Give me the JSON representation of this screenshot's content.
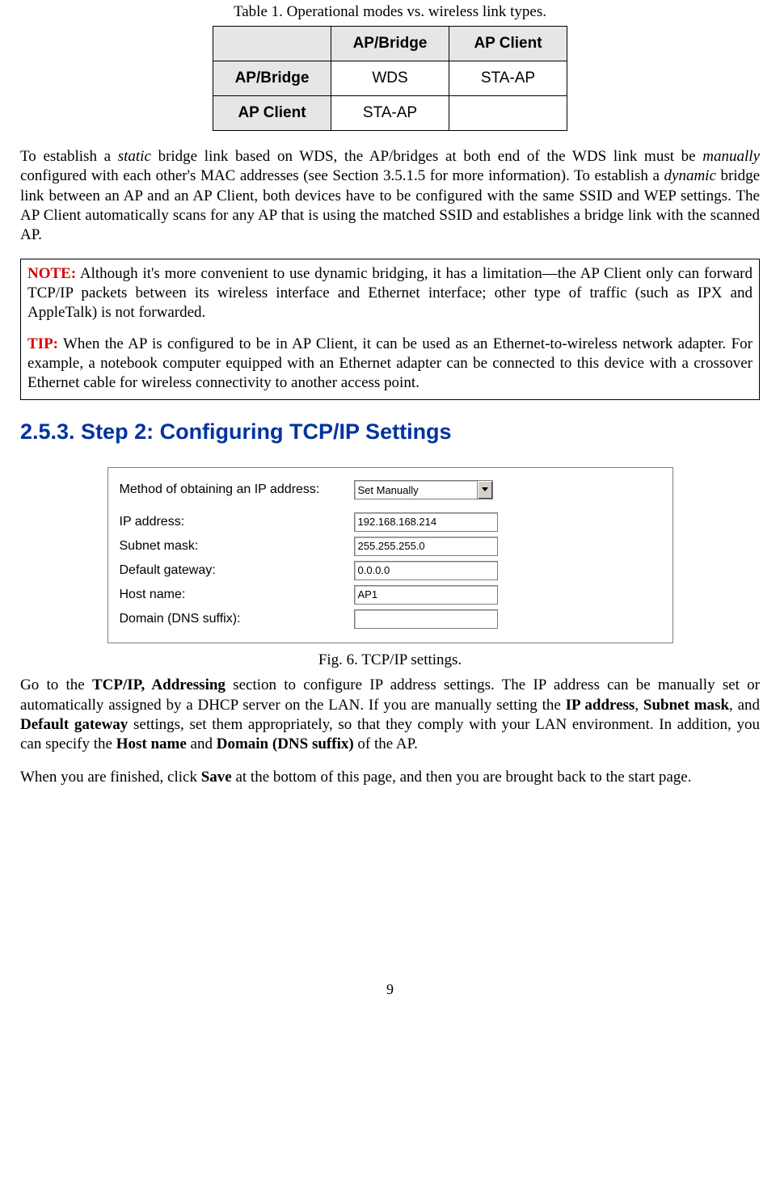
{
  "table": {
    "caption": "Table 1. Operational modes vs. wireless link types.",
    "col1": "AP/Bridge",
    "col2": "AP Client",
    "row1": "AP/Bridge",
    "row2": "AP Client",
    "c11": "WDS",
    "c12": "STA-AP",
    "c21": "STA-AP",
    "c22": ""
  },
  "para1": {
    "t1": "To establish a ",
    "i1": "static",
    "t2": " bridge link based on WDS, the AP/bridges at both end of the WDS link must be ",
    "i2": "manually",
    "t3": " configured with each other's MAC addresses (see Section 3.5.1.5 for more information). To establish a ",
    "i3": "dynamic",
    "t4": " bridge link between an AP and an AP Client, both devices have to be configured with the same SSID and WEP settings. The AP Client automatically scans for any AP that is using the matched SSID and establishes a bridge link with the scanned AP."
  },
  "note": {
    "label": "NOTE:",
    "text": " Although it's more convenient to use dynamic bridging, it has a limitation—the AP Client only can forward TCP/IP packets between its wireless interface and Ethernet interface; other type of traffic (such as IPX and AppleTalk) is not forwarded."
  },
  "tip": {
    "label": "TIP:",
    "text": " When the AP is configured to be in AP Client, it can be used as an Ethernet-to-wireless network adapter. For example, a notebook computer equipped with an Ethernet adapter can be connected to this device with a crossover Ethernet cable for wireless connectivity to another access point."
  },
  "section_heading": "2.5.3. Step 2: Configuring TCP/IP Settings",
  "form": {
    "method_label": "Method of obtaining an IP address:",
    "method_value": "Set Manually",
    "ip_label": "IP address:",
    "ip_value": "192.168.168.214",
    "mask_label": "Subnet mask:",
    "mask_value": "255.255.255.0",
    "gw_label": "Default gateway:",
    "gw_value": "0.0.0.0",
    "host_label": "Host name:",
    "host_value": "AP1",
    "domain_label": "Domain (DNS suffix):",
    "domain_value": ""
  },
  "figure_caption": "Fig. 6. TCP/IP settings.",
  "para2": {
    "t1": "Go to the  ",
    "b1": "TCP/IP, Addressing",
    "t2": " section to configure IP address settings. The IP address can be manually set or automatically assigned by a DHCP server on the LAN. If you are manually setting the ",
    "b2": "IP address",
    "t3": ", ",
    "b3": "Subnet mask",
    "t4": ", and ",
    "b4": "Default gateway",
    "t5": " settings, set them appropriately, so that they comply with your LAN environment. In addition, you can specify the ",
    "b5": "Host name",
    "t6": " and ",
    "b6": "Domain (DNS suffix)",
    "t7": " of the AP."
  },
  "para3": {
    "t1": "When you are finished, click ",
    "b1": "Save",
    "t2": " at the bottom of this page, and then you are brought back to the start page."
  },
  "page_number": "9"
}
